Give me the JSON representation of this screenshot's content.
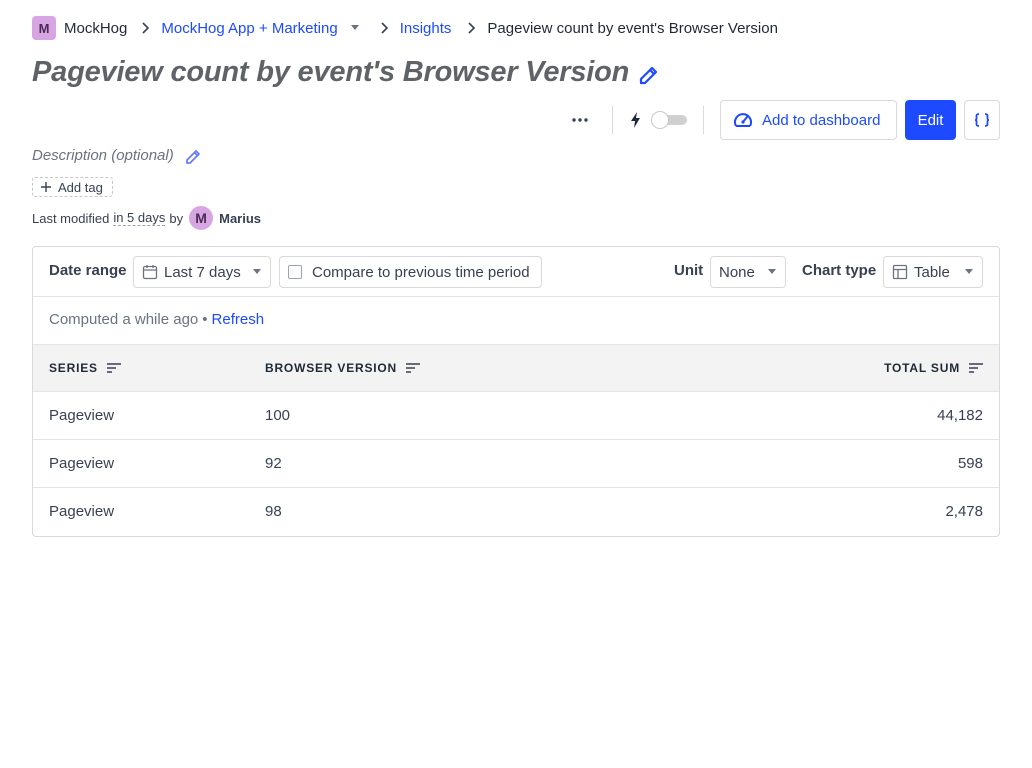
{
  "breadcrumb": {
    "org_initial": "M",
    "org_name": "MockHog",
    "project": "MockHog App + Marketing",
    "section": "Insights",
    "current": "Pageview count by event's Browser Version"
  },
  "insight": {
    "title": "Pageview count by event's Browser Version",
    "description_placeholder": "Description (optional)",
    "add_tag_label": "Add tag",
    "modified_prefix": "Last modified",
    "modified_time": "in 5 days",
    "modified_by_word": "by",
    "author_initial": "M",
    "author_name": "Marius"
  },
  "toolbar": {
    "add_to_dashboard_label": "Add to dashboard",
    "edit_label": "Edit",
    "live_toggle_on": false
  },
  "filters": {
    "date_range_label": "Date range",
    "date_range_value": "Last 7 days",
    "compare_label": "Compare to previous time period",
    "compare_checked": false,
    "unit_label": "Unit",
    "unit_value": "None",
    "chart_type_label": "Chart type",
    "chart_type_value": "Table"
  },
  "status": {
    "computed_text": "Computed a while ago",
    "separator": "•",
    "refresh_label": "Refresh"
  },
  "table": {
    "columns": [
      "SERIES",
      "BROWSER VERSION",
      "TOTAL SUM"
    ],
    "rows": [
      {
        "series": "Pageview",
        "browser_version": "100",
        "total_sum": "44,182"
      },
      {
        "series": "Pageview",
        "browser_version": "92",
        "total_sum": "598"
      },
      {
        "series": "Pageview",
        "browser_version": "98",
        "total_sum": "2,478"
      }
    ]
  },
  "colors": {
    "accent": "#1d4aff",
    "avatar": "#d7a6e2",
    "header_bg": "#f3f3f3"
  }
}
